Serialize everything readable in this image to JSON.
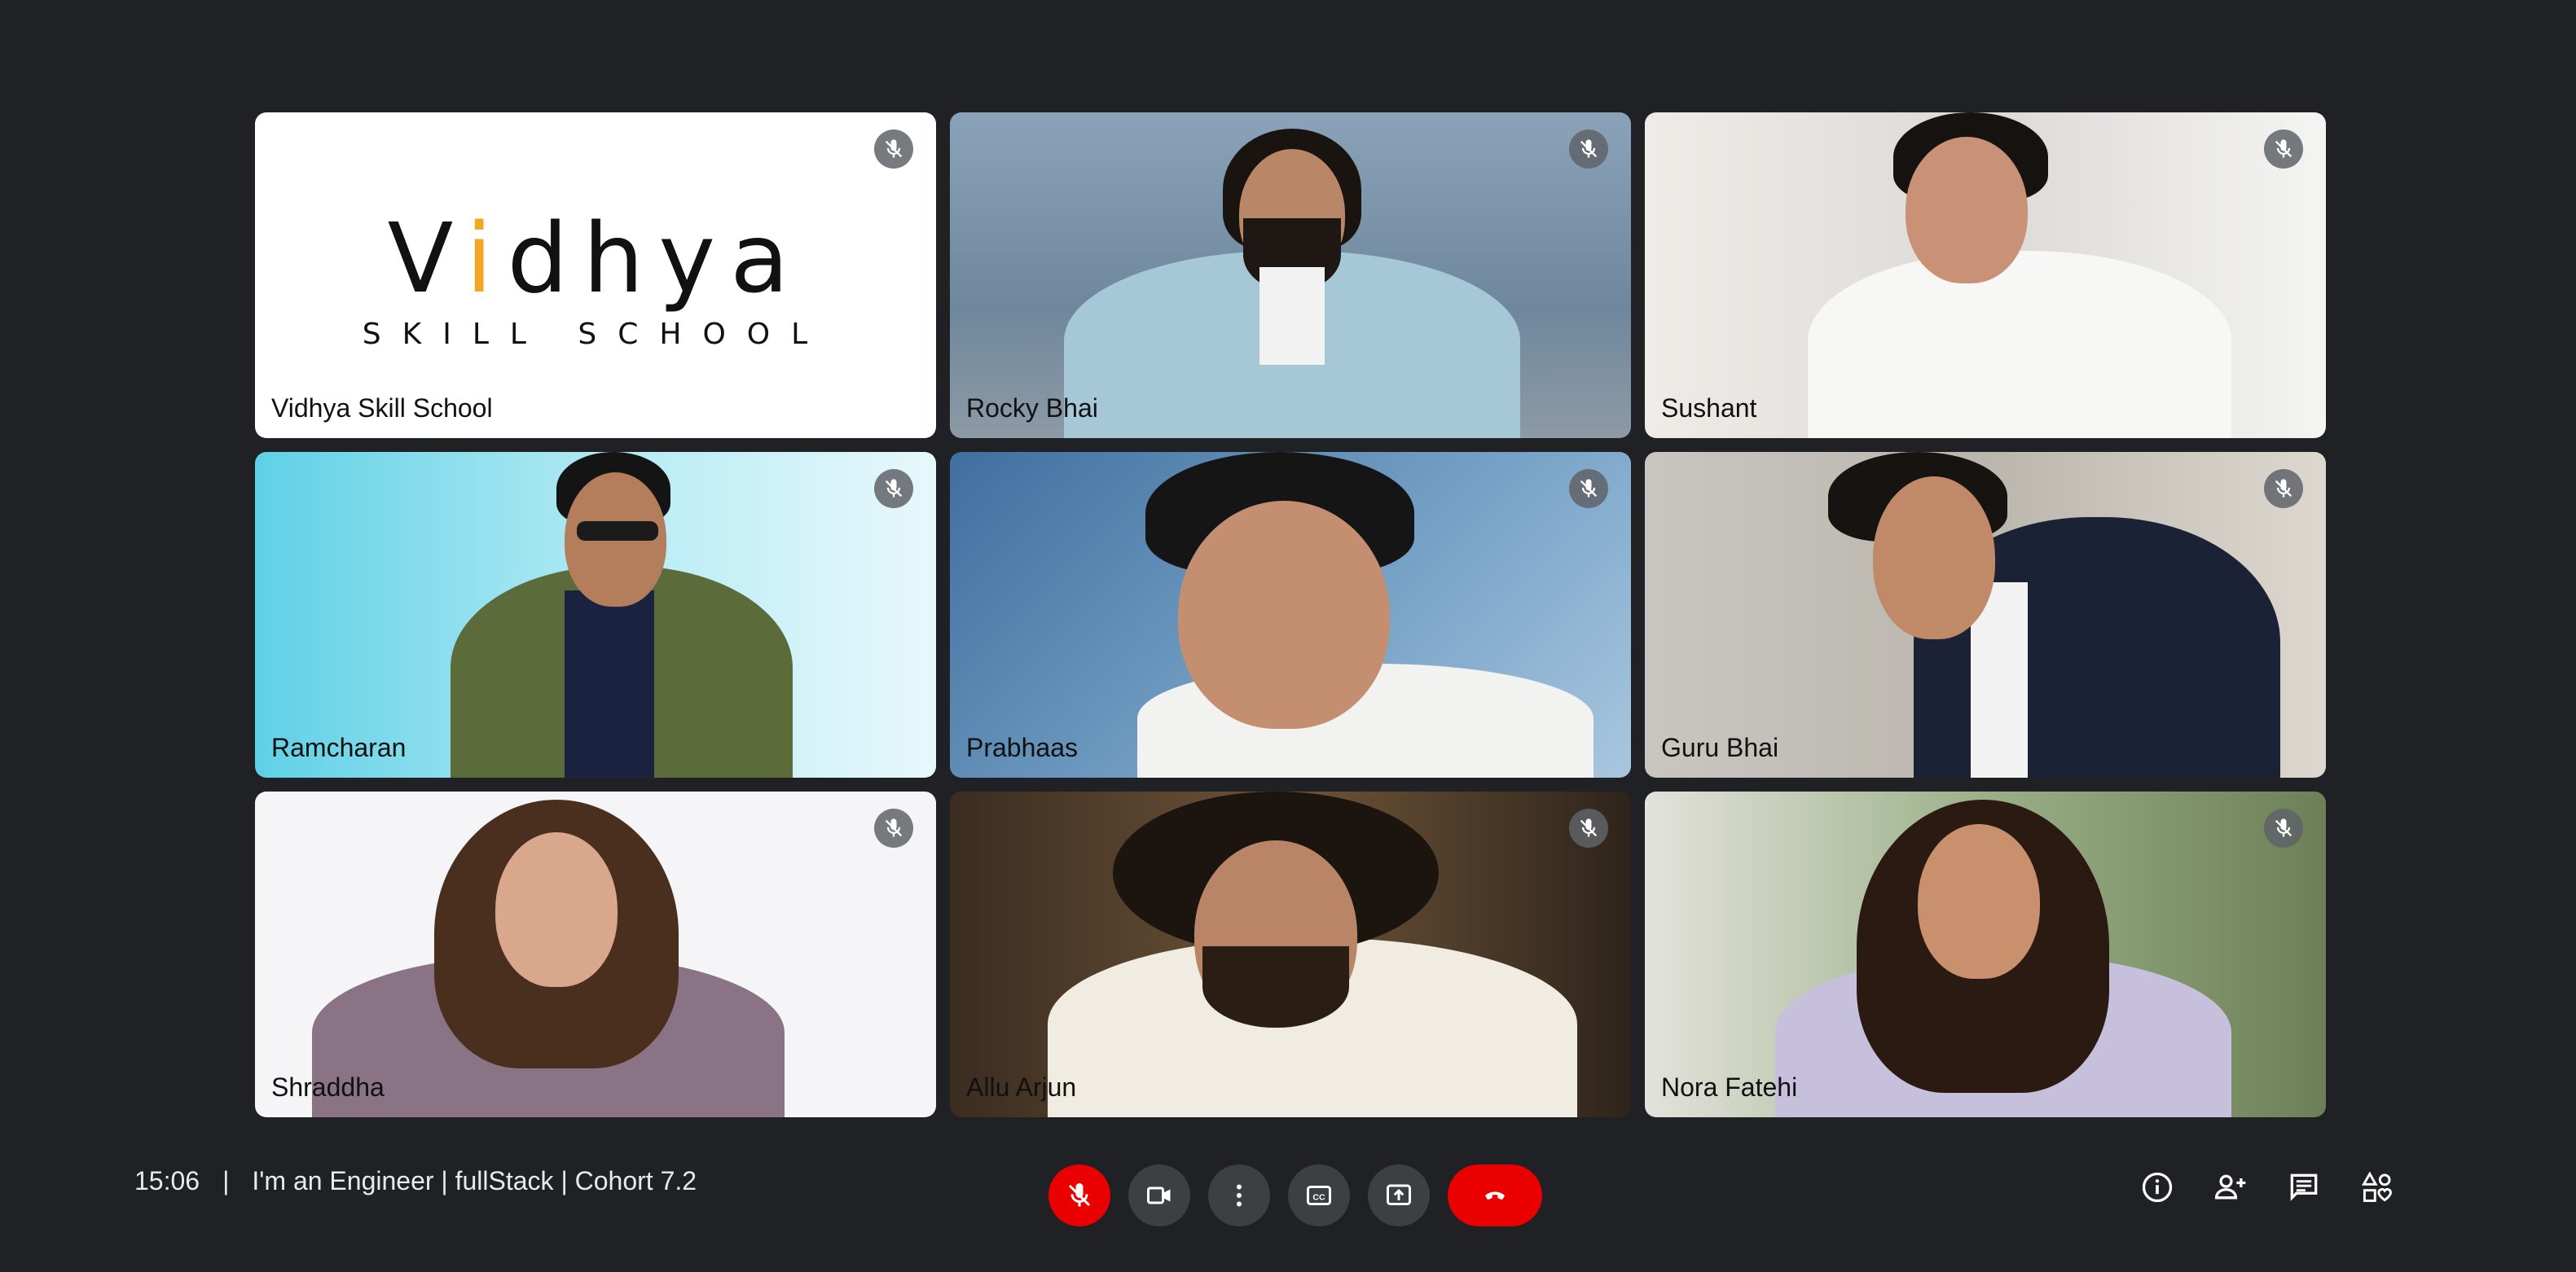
{
  "meeting": {
    "time": "15:06",
    "separator": "|",
    "title": "I'm an Engineer | fullStack | Cohort 7.2"
  },
  "participants": [
    {
      "name": "Vidhya Skill School",
      "muted": true,
      "bg": "#ffffff"
    },
    {
      "name": "Rocky Bhai",
      "muted": true,
      "bg": "#7f97ad"
    },
    {
      "name": "Sushant",
      "muted": true,
      "bg": "#e9e6e3"
    },
    {
      "name": "Ramcharan",
      "muted": true,
      "bg": "#8fdcec"
    },
    {
      "name": "Prabhaas",
      "muted": true,
      "bg": "#5f88b4"
    },
    {
      "name": "Guru Bhai",
      "muted": true,
      "bg": "#cfcbc4"
    },
    {
      "name": "Shraddha",
      "muted": true,
      "bg": "#f4f4f6"
    },
    {
      "name": "Allu Arjun",
      "muted": true,
      "bg": "#4a3a2a"
    },
    {
      "name": "Nora Fatehi",
      "muted": true,
      "bg": "#b9c6b0"
    }
  ],
  "logo": {
    "text_left": "V",
    "text_accent": "i",
    "text_right": "dhya",
    "subtitle": "SKILL SCHOOL"
  },
  "controls": [
    "mic-off",
    "camera",
    "more-options",
    "captions",
    "present",
    "end-call"
  ],
  "right_controls": [
    "meeting-info",
    "people",
    "chat",
    "activities"
  ],
  "colors": {
    "background": "#202124",
    "danger": "#ea0000",
    "control": "#3c4043",
    "logo_accent": "#f4a623"
  }
}
